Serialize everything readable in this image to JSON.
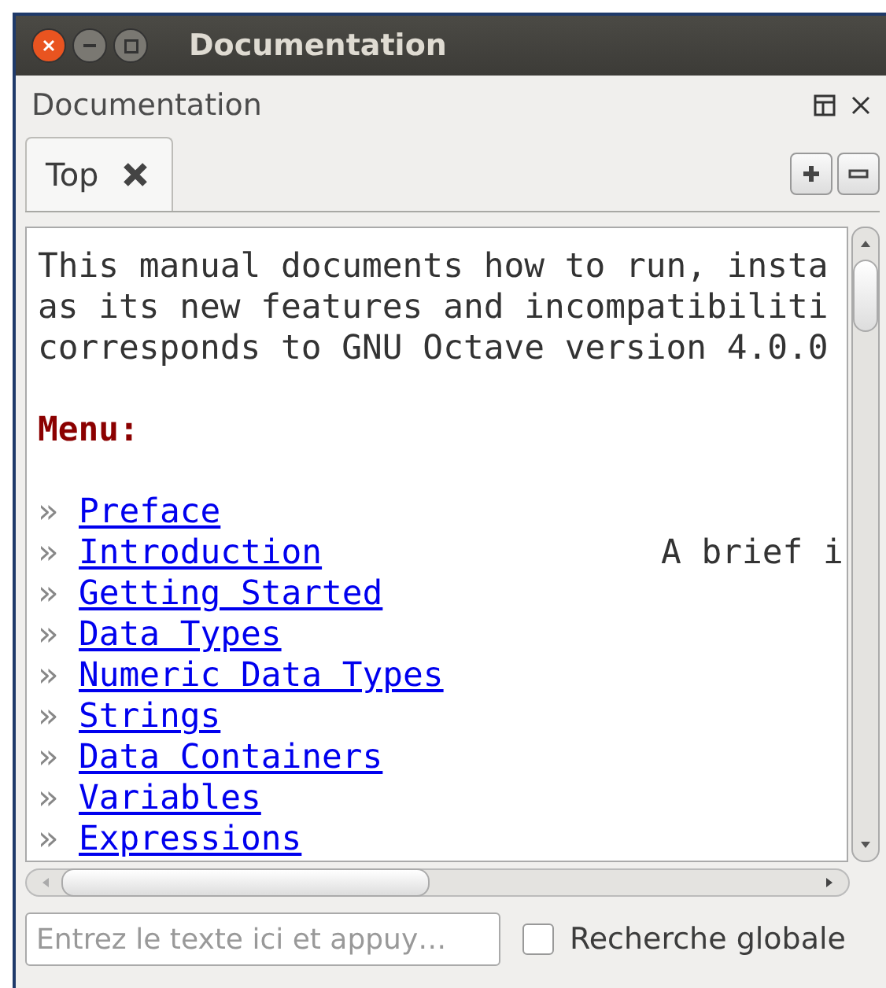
{
  "window": {
    "title": "Documentation"
  },
  "panel": {
    "title": "Documentation"
  },
  "tabs": [
    {
      "label": "Top",
      "selected": true
    }
  ],
  "content": {
    "paragraph": [
      "This manual documents how to run, insta",
      "as its new features and incompatibiliti",
      "corresponds to GNU Octave version 4.0.0"
    ],
    "menu_heading": "Menu:",
    "menu": [
      {
        "bullet": "»",
        "link": "Preface"
      },
      {
        "bullet": "»",
        "link": "Introduction",
        "description": "A brief i"
      },
      {
        "bullet": "»",
        "link": "Getting Started"
      },
      {
        "bullet": "»",
        "link": "Data Types"
      },
      {
        "bullet": "»",
        "link": "Numeric Data Types"
      },
      {
        "bullet": "»",
        "link": "Strings"
      },
      {
        "bullet": "»",
        "link": "Data Containers"
      },
      {
        "bullet": "»",
        "link": "Variables"
      },
      {
        "bullet": "»",
        "link": "Expressions"
      }
    ]
  },
  "search": {
    "placeholder": "Entrez le texte ici et appuy…",
    "global_label": "Recherche globale",
    "global_checked": false
  }
}
